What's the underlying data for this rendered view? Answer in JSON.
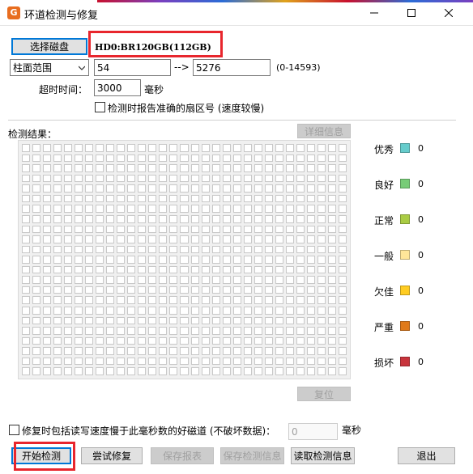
{
  "window": {
    "title": "环道检测与修复",
    "icon_letter": "G"
  },
  "disk": {
    "select_button": "选择磁盘",
    "display": "HD0:BR120GB(112GB)"
  },
  "range": {
    "mode": "柱面范围",
    "start": "54",
    "arrow": "-->",
    "end": "5276",
    "limit": "(0-14593)"
  },
  "timeout": {
    "label": "超时时间：",
    "value": "3000",
    "unit": "毫秒"
  },
  "options": {
    "report_sector": "检测时报告准确的扇区号 (速度较慢)",
    "repair_slow": "修复时包括读写速度慢于此毫秒数的好磁道 (不破坏数据)：",
    "repair_value": "0",
    "repair_unit": "毫秒"
  },
  "results": {
    "label": "检测结果：",
    "detail_button": "详细信息",
    "reset_button": "复位"
  },
  "legend": [
    {
      "label": "优秀",
      "count": "0",
      "color": "#66cccc"
    },
    {
      "label": "良好",
      "count": "0",
      "color": "#77cc77"
    },
    {
      "label": "正常",
      "count": "0",
      "color": "#aacc44"
    },
    {
      "label": "一般",
      "count": "0",
      "color": "#ffe699"
    },
    {
      "label": "欠佳",
      "count": "0",
      "color": "#ffcc22"
    },
    {
      "label": "严重",
      "count": "0",
      "color": "#e07a1a"
    },
    {
      "label": "损坏",
      "count": "0",
      "color": "#c8343c"
    }
  ],
  "buttons": {
    "start": "开始检测",
    "try_repair": "尝试修复",
    "save_report": "保存报表",
    "save_info": "保存检测信息",
    "load_info": "读取检测信息",
    "exit": "退出"
  }
}
